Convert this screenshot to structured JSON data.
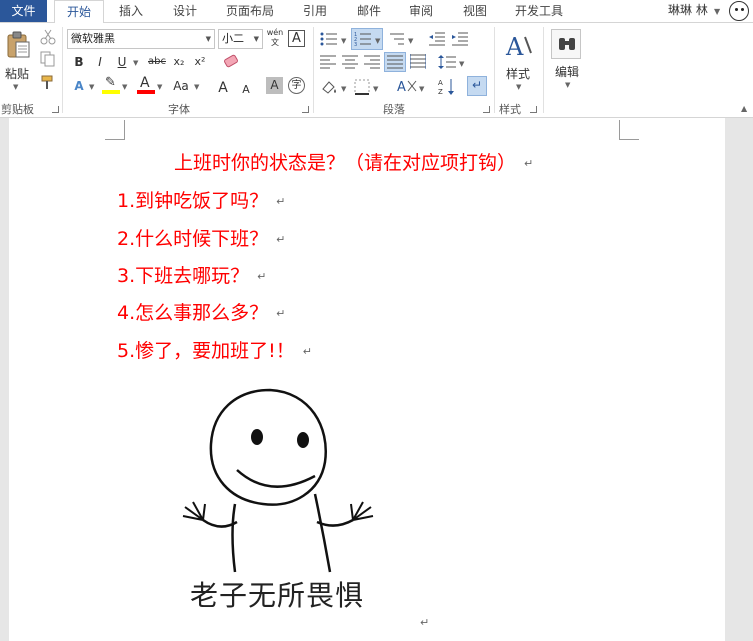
{
  "tabs": {
    "file": "文件",
    "items": [
      "开始",
      "插入",
      "设计",
      "页面布局",
      "引用",
      "邮件",
      "审阅",
      "视图",
      "开发工具"
    ],
    "active_index": 0
  },
  "user": {
    "name": "琳琳 林"
  },
  "ribbon": {
    "clipboard": {
      "label": "剪贴板",
      "paste": "粘贴"
    },
    "font": {
      "label": "字体",
      "font_name": "微软雅黑",
      "font_size": "小二",
      "wen_glyph": "wén\n文",
      "bold": "B",
      "italic": "I",
      "underline": "U",
      "strike": "abc",
      "subscript": "x₂",
      "superscript": "x²",
      "text_effect": "A",
      "grow": "A",
      "shrink": "A",
      "case": "Aa",
      "font_color": "A",
      "char_border": "A",
      "shading": "A",
      "phonetic": "字"
    },
    "paragraph": {
      "label": "段落"
    },
    "styles": {
      "label": "样式",
      "button": "样式"
    },
    "editing": {
      "button": "编辑"
    }
  },
  "document": {
    "title": "上班时你的状态是？（请在对应项打钩）",
    "items": [
      "1.到钟吃饭了吗？",
      "2.什么时候下班？",
      "3.下班去哪玩？",
      "4.怎么事那么多？",
      "5.惨了，要加班了!！"
    ],
    "meme_caption": "老子无所畏惧",
    "para_mark": "↵"
  },
  "colors": {
    "file_tab_bg": "#2b579a",
    "accent_text": "#ff0000",
    "font_color_bar": "#ff0000",
    "highlight_bar": "#ffff00"
  }
}
